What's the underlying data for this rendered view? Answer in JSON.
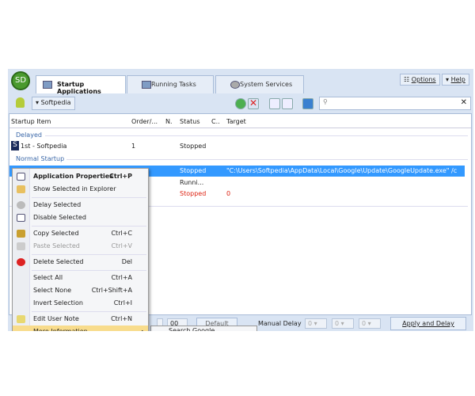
{
  "app": {
    "logo": "SD"
  },
  "tabs": [
    {
      "label": "Startup Applications",
      "active": true
    },
    {
      "label": "Running Tasks"
    },
    {
      "label": "System Services"
    }
  ],
  "header_buttons": {
    "options": "Options",
    "help": "Help"
  },
  "toolbar": {
    "profile": "Softpedia",
    "search_placeholder": "",
    "clear": "✕"
  },
  "columns": [
    "Startup Item",
    "Order/...",
    "N.",
    "Status",
    "C..",
    "Target"
  ],
  "groups": {
    "delayed": "Delayed",
    "normal": "Normal Startup"
  },
  "rows": [
    {
      "item": "1st - Softpedia",
      "order": "1",
      "status": "Stopped",
      "c": "",
      "target": ""
    },
    {
      "item": "",
      "order": "ard",
      "status": "Stopped",
      "c": "",
      "target": "\"C:\\Users\\Softpedia\\AppData\\Local\\Google\\Update\\GoogleUpdate.exe\" /c",
      "selected": true
    },
    {
      "item": "",
      "order": "ard",
      "status": "Runni...",
      "c": "",
      "target": ""
    },
    {
      "item": "",
      "order": "ard",
      "status": "Stopped",
      "c": "0",
      "target": "",
      "error": true
    }
  ],
  "context_menu": [
    {
      "label": "Application Properties",
      "shortcut": "Ctrl+P",
      "bold": true
    },
    {
      "label": "Show Selected in Explorer",
      "shortcut": ""
    },
    {
      "label": "Delay Selected",
      "shortcut": ""
    },
    {
      "label": "Disable Selected",
      "shortcut": ""
    },
    {
      "label": "Copy Selected",
      "shortcut": "Ctrl+C"
    },
    {
      "label": "Paste Selected",
      "shortcut": "Ctrl+V",
      "disabled": true
    },
    {
      "label": "Delete Selected",
      "shortcut": "Del"
    },
    {
      "label": "Select All",
      "shortcut": "Ctrl+A"
    },
    {
      "label": "Select None",
      "shortcut": "Ctrl+Shift+A"
    },
    {
      "label": "Invert Selection",
      "shortcut": "Ctrl+I"
    },
    {
      "label": "Edit User Note",
      "shortcut": "Ctrl+N"
    },
    {
      "label": "More Information",
      "shortcut": "▸",
      "highlighted": true
    }
  ],
  "submenu": {
    "first": "Search Google"
  },
  "bottom": {
    "minutes": "00",
    "default_btn": "Default",
    "manual_delay": "Manual Delay",
    "delays": [
      "0",
      "0",
      "0"
    ],
    "apply": "Apply and Delay"
  }
}
